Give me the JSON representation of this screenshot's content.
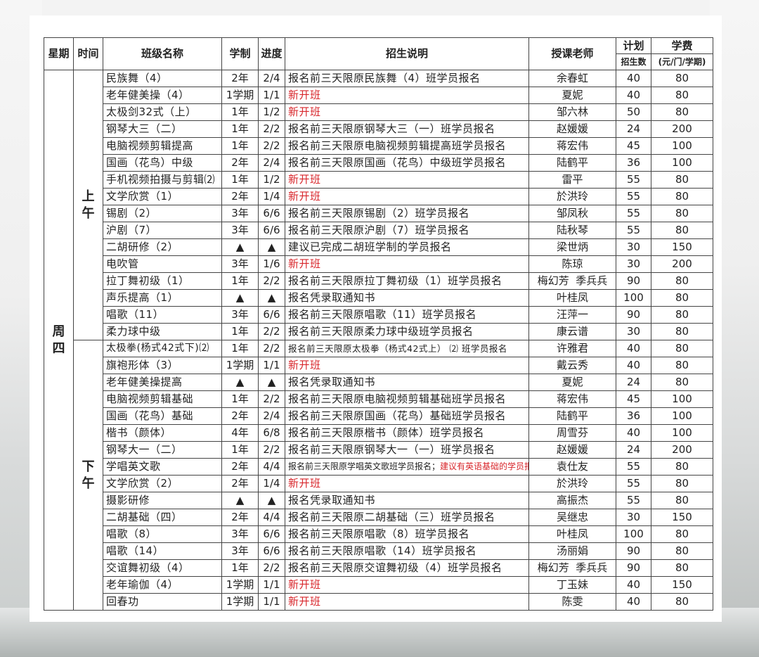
{
  "header": {
    "day": "星期",
    "time": "时间",
    "class_name": "班级名称",
    "duration": "学制",
    "progress": "进度",
    "description": "招生说明",
    "teacher": "授课老师",
    "plan": "计划",
    "plan_sub": "招生数",
    "fee": "学费",
    "fee_sub": "(元/门/学期)"
  },
  "day": "周四",
  "periods": {
    "morning": "上午",
    "afternoon": "下午"
  },
  "morning_rows": [
    {
      "name": "民族舞（4）",
      "duration": "2年",
      "progress": "2/4",
      "desc": "报名前三天限原民族舞（4）班学员报名",
      "desc_red": false,
      "teacher": "余春虹",
      "plan": "40",
      "fee": "80"
    },
    {
      "name": "老年健美操（4）",
      "duration": "1学期",
      "progress": "1/1",
      "desc": "新开班",
      "desc_red": true,
      "teacher": "夏妮",
      "plan": "40",
      "fee": "80"
    },
    {
      "name": "太极剑32式（上）",
      "duration": "1年",
      "progress": "1/2",
      "desc": "新开班",
      "desc_red": true,
      "teacher": "邹六林",
      "plan": "50",
      "fee": "80"
    },
    {
      "name": "钢琴大三（二）",
      "duration": "1年",
      "progress": "2/2",
      "desc": "报名前三天限原钢琴大三（一）班学员报名",
      "desc_red": false,
      "teacher": "赵媛媛",
      "plan": "24",
      "fee": "200"
    },
    {
      "name": "电脑视频剪辑提高",
      "duration": "1年",
      "progress": "2/2",
      "desc": "报名前三天限原电脑视频剪辑提高班学员报名",
      "desc_red": false,
      "teacher": "蒋宏伟",
      "plan": "45",
      "fee": "100"
    },
    {
      "name": "国画（花鸟）中级",
      "duration": "2年",
      "progress": "2/4",
      "desc": "报名前三天限原国画（花鸟）中级班学员报名",
      "desc_red": false,
      "teacher": "陆鹤平",
      "plan": "36",
      "fee": "100"
    },
    {
      "name": "手机视频拍摄与剪辑⑵",
      "duration": "1年",
      "progress": "1/2",
      "desc": "新开班",
      "desc_red": true,
      "teacher": "雷平",
      "plan": "55",
      "fee": "80"
    },
    {
      "name": "文学欣赏（1）",
      "duration": "2年",
      "progress": "1/4",
      "desc": "新开班",
      "desc_red": true,
      "teacher": "於洪玲",
      "plan": "55",
      "fee": "80"
    },
    {
      "name": "锡剧（2）",
      "duration": "3年",
      "progress": "6/6",
      "desc": "报名前三天限原锡剧（2）班学员报名",
      "desc_red": false,
      "teacher": "邹凤秋",
      "plan": "55",
      "fee": "80"
    },
    {
      "name": "沪剧（7）",
      "duration": "3年",
      "progress": "6/6",
      "desc": "报名前三天限原沪剧（7）班学员报名",
      "desc_red": false,
      "teacher": "陆秋琴",
      "plan": "55",
      "fee": "80"
    },
    {
      "name": "二胡研修（2）",
      "duration": "▲",
      "progress": "▲",
      "desc": "建议已完成二胡班学制的学员报名",
      "desc_red": false,
      "teacher": "梁世炳",
      "plan": "30",
      "fee": "150"
    },
    {
      "name": "电吹管",
      "duration": "3年",
      "progress": "1/6",
      "desc": "新开班",
      "desc_red": true,
      "teacher": "陈琼",
      "plan": "30",
      "fee": "200"
    },
    {
      "name": "拉丁舞初级（1）",
      "duration": "1年",
      "progress": "2/2",
      "desc": "报名前三天限原拉丁舞初级（1）班学员报名",
      "desc_red": false,
      "teacher": "梅幻芳  季兵兵",
      "plan": "90",
      "fee": "80"
    },
    {
      "name": "声乐提高（1）",
      "duration": "▲",
      "progress": "▲",
      "desc": "报名凭录取通知书",
      "desc_red": false,
      "teacher": "叶桂凤",
      "plan": "100",
      "fee": "80"
    },
    {
      "name": "唱歌（11）",
      "duration": "3年",
      "progress": "6/6",
      "desc": "报名前三天限原唱歌（11）班学员报名",
      "desc_red": false,
      "teacher": "汪萍一",
      "plan": "90",
      "fee": "80"
    },
    {
      "name": "柔力球中级",
      "duration": "1年",
      "progress": "2/2",
      "desc": "报名前三天限原柔力球中级班学员报名",
      "desc_red": false,
      "teacher": "康云谱",
      "plan": "30",
      "fee": "80"
    }
  ],
  "afternoon_rows": [
    {
      "name": "太极拳(杨式42式下)⑵",
      "duration": "1年",
      "progress": "2/2",
      "desc": "报名前三天限原太极拳（杨式42式上） ⑵ 班学员报名",
      "desc_red": false,
      "teacher": "许雅君",
      "plan": "40",
      "fee": "80"
    },
    {
      "name": "旗袍形体（3）",
      "duration": "1学期",
      "progress": "1/1",
      "desc": "新开班",
      "desc_red": true,
      "teacher": "戴云秀",
      "plan": "40",
      "fee": "80"
    },
    {
      "name": "老年健美操提高",
      "duration": "▲",
      "progress": "▲",
      "desc": "报名凭录取通知书",
      "desc_red": false,
      "teacher": "夏妮",
      "plan": "24",
      "fee": "80"
    },
    {
      "name": "电脑视频剪辑基础",
      "duration": "1年",
      "progress": "2/2",
      "desc": "报名前三天限原电脑视频剪辑基础班学员报名",
      "desc_red": false,
      "teacher": "蒋宏伟",
      "plan": "45",
      "fee": "100"
    },
    {
      "name": "国画（花鸟）基础",
      "duration": "2年",
      "progress": "2/4",
      "desc": "报名前三天限原国画（花鸟）基础班学员报名",
      "desc_red": false,
      "teacher": "陆鹤平",
      "plan": "36",
      "fee": "100"
    },
    {
      "name": "楷书（颜体）",
      "duration": "4年",
      "progress": "6/8",
      "desc": "报名前三天限原楷书（颜体）班学员报名",
      "desc_red": false,
      "teacher": "周雪芬",
      "plan": "40",
      "fee": "100"
    },
    {
      "name": "钢琴大一（二）",
      "duration": "1年",
      "progress": "2/2",
      "desc": "报名前三天限原钢琴大一（一）班学员报名",
      "desc_red": false,
      "teacher": "赵媛媛",
      "plan": "24",
      "fee": "200"
    },
    {
      "name": "学唱英文歌",
      "duration": "2年",
      "progress": "4/4",
      "desc": "报名前三天限原学唱英文歌班学员报名；",
      "desc_extra": "建议有英语基础的学员报名",
      "desc_red": false,
      "teacher": "袁仕友",
      "plan": "55",
      "fee": "80"
    },
    {
      "name": "文学欣赏（2）",
      "duration": "2年",
      "progress": "1/4",
      "desc": "新开班",
      "desc_red": true,
      "teacher": "於洪玲",
      "plan": "55",
      "fee": "80"
    },
    {
      "name": "摄影研修",
      "duration": "▲",
      "progress": "▲",
      "desc": "报名凭录取通知书",
      "desc_red": false,
      "teacher": "高振杰",
      "plan": "55",
      "fee": "80"
    },
    {
      "name": "二胡基础（四）",
      "duration": "2年",
      "progress": "4/4",
      "desc": "报名前三天限原二胡基础（三）班学员报名",
      "desc_red": false,
      "teacher": "吴继忠",
      "plan": "30",
      "fee": "150"
    },
    {
      "name": "唱歌（8）",
      "duration": "3年",
      "progress": "6/6",
      "desc": "报名前三天限原唱歌（8）班学员报名",
      "desc_red": false,
      "teacher": "叶桂凤",
      "plan": "100",
      "fee": "80"
    },
    {
      "name": "唱歌（14）",
      "duration": "3年",
      "progress": "6/6",
      "desc": "报名前三天限原唱歌（14）班学员报名",
      "desc_red": false,
      "teacher": "汤丽娟",
      "plan": "90",
      "fee": "80"
    },
    {
      "name": "交谊舞初级（4）",
      "duration": "1年",
      "progress": "2/2",
      "desc": "报名前三天限原交谊舞初级（4）班学员报名",
      "desc_red": false,
      "teacher": "梅幻芳  季兵兵",
      "plan": "90",
      "fee": "80"
    },
    {
      "name": "老年瑜伽（4）",
      "duration": "1学期",
      "progress": "1/1",
      "desc": "新开班",
      "desc_red": true,
      "teacher": "丁玉妹",
      "plan": "40",
      "fee": "150"
    },
    {
      "name": "回春功",
      "duration": "1学期",
      "progress": "1/1",
      "desc": "新开班",
      "desc_red": true,
      "teacher": "陈雯",
      "plan": "40",
      "fee": "80"
    }
  ],
  "colors": {
    "highlight": "#d8262b",
    "border": "#444444"
  }
}
